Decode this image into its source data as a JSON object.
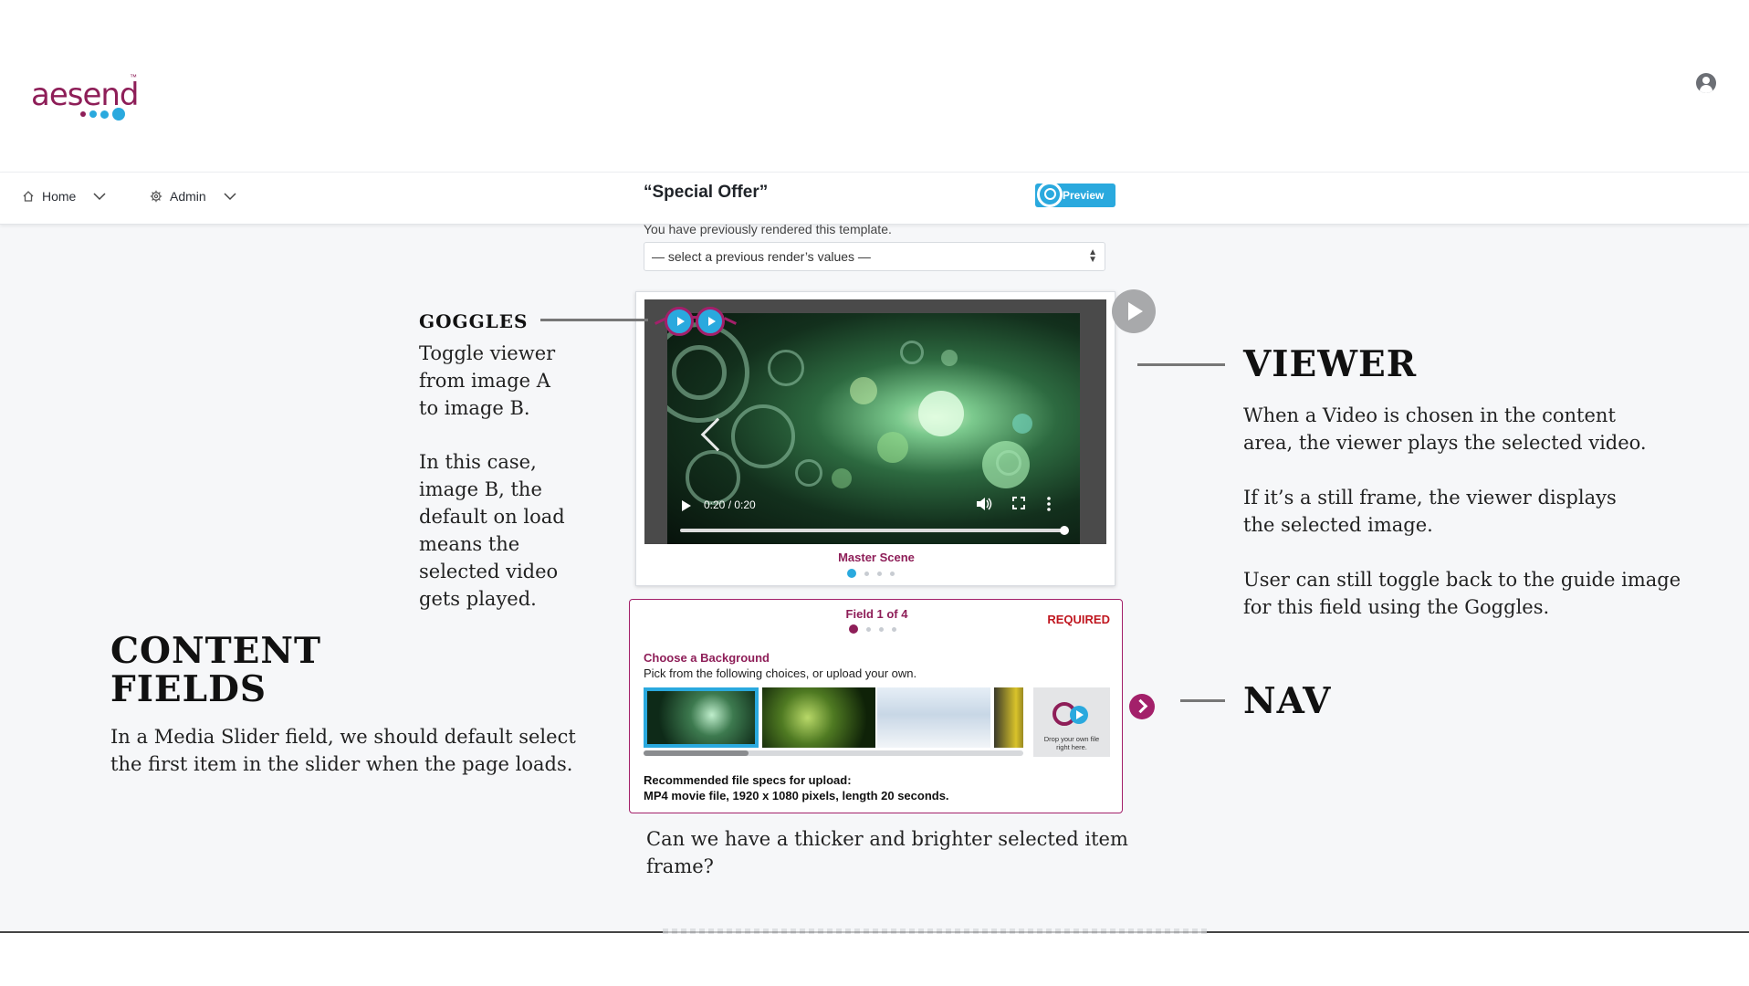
{
  "app": {
    "logo_text": "aesend",
    "logo_tm": "™",
    "brand_colors": {
      "magenta": "#8e1e58",
      "blue": "#2aa9de"
    }
  },
  "nav": {
    "items": [
      {
        "label": "Home",
        "icon": "home-icon"
      },
      {
        "label": "Admin",
        "icon": "gear-icon"
      }
    ]
  },
  "template": {
    "title": "“Special Offer”",
    "preview_label": "Preview",
    "prev_render_note": "You have previously rendered this template.",
    "select_value": "— select a previous render’s values —"
  },
  "viewer": {
    "time": "0:20 / 0:20",
    "progress": 1.0,
    "scene_label": "Master Scene",
    "scene_dots": 4,
    "scene_active": 0
  },
  "field": {
    "count_label": "Field 1 of 4",
    "required_label": "REQUIRED",
    "dots": 4,
    "active": 0,
    "title": "Choose a Background",
    "subtitle": "Pick from the following choices, or upload your own.",
    "drop_text": "Drop your own file right here.",
    "specs_line1": "Recommended file specs for upload:",
    "specs_line2": "MP4 movie file, 1920 x 1080 pixels, length 20 seconds."
  },
  "annotations": {
    "goggles": {
      "heading": "GOGGLES",
      "body1": "Toggle viewer\nfrom image A\nto image B.",
      "body2": "In this case,\nimage B, the\ndefault on load\nmeans the\nselected video\ngets played."
    },
    "viewer": {
      "heading": "VIEWER",
      "body1": "When a Video is chosen in the content\narea, the viewer plays the selected video.",
      "body2": "If it’s a still frame, the viewer displays\nthe selected image.",
      "body3": "User can still toggle back to the guide image\nfor this field using the Goggles."
    },
    "content_fields": {
      "heading": "CONTENT\nFIELDS",
      "body": "In a Media Slider field, we should default select\nthe first item in the slider when the page loads."
    },
    "nav": {
      "heading": "NAV"
    },
    "frame_note": "Can we have a thicker and brighter selected item\nframe?"
  }
}
